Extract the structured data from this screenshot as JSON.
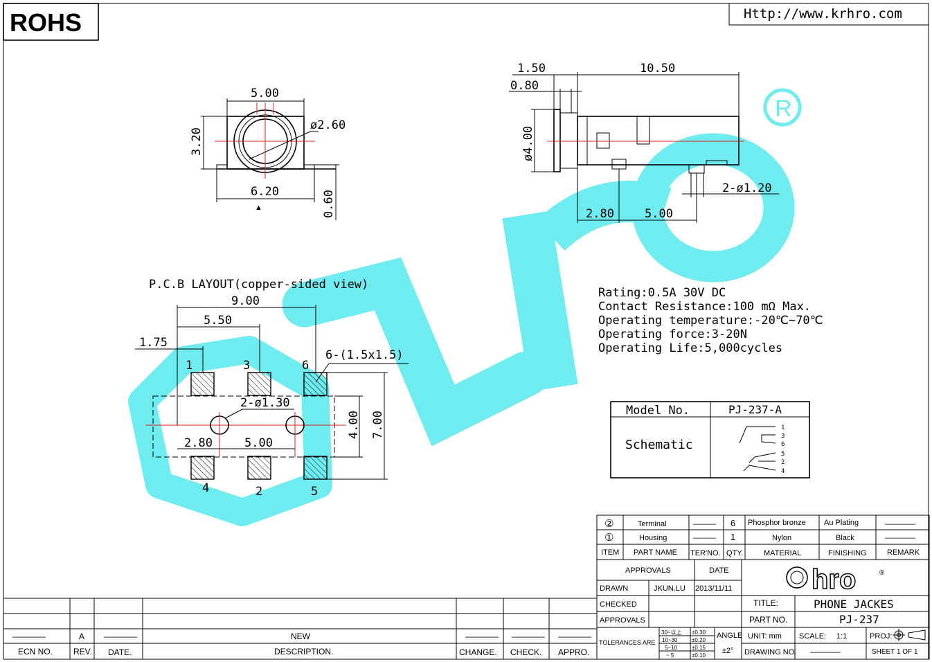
{
  "header": {
    "rohs": "ROHS",
    "website": "Http://www.krhro.com"
  },
  "front_view": {
    "width_top": "5.00",
    "height": "3.20",
    "diameter": "ø2.60",
    "width_bottom": "6.20",
    "height_pin": "0.60",
    "mark": "▲"
  },
  "side_view": {
    "dim_a": "1.50",
    "dim_b": "0.80",
    "dim_len": "10.50",
    "diameter": "ø4.00",
    "holes": "2-ø1.20",
    "dim_c": "2.80",
    "dim_d": "5.00"
  },
  "pcb": {
    "title": "P.C.B  LAYOUT(copper-sided view)",
    "dim_total": "9.00",
    "dim_mid": "5.50",
    "dim_left": "1.75",
    "pads": "6-(1.5x1.5)",
    "holes": "2-ø1.30",
    "dim_c": "2.80",
    "dim_d": "5.00",
    "dim_h1": "4.00",
    "dim_h2": "7.00",
    "pin_labels": [
      "1",
      "3",
      "6",
      "4",
      "2",
      "5"
    ]
  },
  "specs": [
    "Rating:0.5A  30V  DC",
    "Contact  Resistance:100  mΩ  Max.",
    "Operating  temperature:-20℃~70℃",
    "Operating  force:3-20N",
    "Operating  Life:5,000cycles"
  ],
  "model_box": {
    "model_label": "Model No.",
    "model_value": "PJ-237-A",
    "schematic_label": "Schematic",
    "pins": [
      "1",
      "3",
      "6",
      "5",
      "2",
      "4"
    ]
  },
  "bom": {
    "rows": [
      {
        "item": "②",
        "name": "Terminal",
        "ter": "———",
        "qty": "6",
        "material": "Phosphor bronze",
        "finishing": "Au Plating",
        "remark": "————"
      },
      {
        "item": "①",
        "name": "Housing",
        "ter": "———",
        "qty": "1",
        "material": "Nylon",
        "finishing": "Black",
        "remark": "————"
      }
    ],
    "header": {
      "item": "ITEM",
      "name": "PART  NAME",
      "ter": "TER'NO.",
      "qty": "QTY.",
      "material": "MATERIAL",
      "finishing": "FINISHING",
      "remark": "REMARK"
    }
  },
  "title_block": {
    "approvals": "APPROVALS",
    "date": "DATE",
    "drawn": "DRAWN",
    "drawn_by": "JKUN.LU",
    "drawn_date": "2013/11/11",
    "checked": "CHECKED",
    "approvals2": "APPROVALS",
    "logo": "hro",
    "title_label": "TITLE:",
    "title_value": "PHONE  JACKES",
    "part_label": "PART  NO.",
    "part_value": "PJ-237",
    "tolerances": "TOLERANCES  ARE",
    "tol_ranges": [
      "30~以上",
      "10~30",
      "5~10",
      "~ 5"
    ],
    "tol_values": [
      "±0.30",
      "±0.20",
      "±0.15",
      "±0.10"
    ],
    "angle": "ANGLE",
    "angle_value": "±2°",
    "unit": "UNIT:  mm",
    "scale": "SCALE:",
    "scale_value": "1:1",
    "proj": "PROJ:",
    "drawing_no": "DRAWING  NO.",
    "drawing_no_value": "————",
    "sheet": "SHEET   1  OF  1"
  },
  "revision": {
    "headers": [
      "ECN  NO.",
      "REV.",
      "DATE.",
      "DESCRIPTION.",
      "CHANGE.",
      "CHECK.",
      "APPRO."
    ],
    "row": [
      "————",
      "A",
      "————",
      "NEW",
      "————",
      "————",
      "————"
    ]
  },
  "watermark": {
    "color": "#3ee6ea"
  }
}
